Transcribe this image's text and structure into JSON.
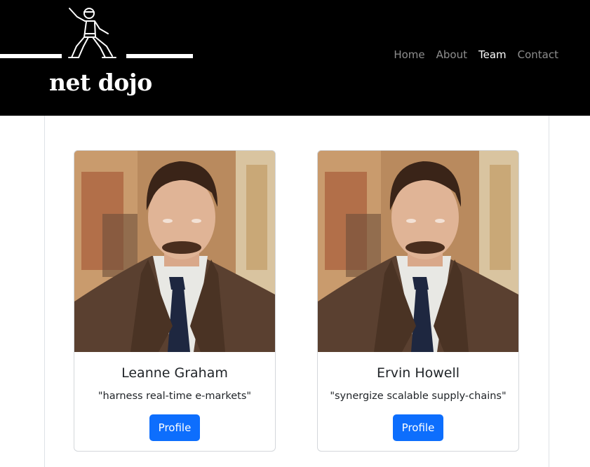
{
  "brand": {
    "name": "net dojo"
  },
  "nav": {
    "items": [
      {
        "label": "Home",
        "active": false
      },
      {
        "label": "About",
        "active": false
      },
      {
        "label": "Team",
        "active": true
      },
      {
        "label": "Contact",
        "active": false
      }
    ]
  },
  "team": {
    "members": [
      {
        "name": "Leanne Graham",
        "catchphrase": "\"harness real-time e-markets\"",
        "button_label": "Profile"
      },
      {
        "name": "Ervin Howell",
        "catchphrase": "\"synergize scalable supply-chains\"",
        "button_label": "Profile"
      }
    ]
  },
  "colors": {
    "navbar_bg": "#000000",
    "primary": "#0d6efd"
  }
}
